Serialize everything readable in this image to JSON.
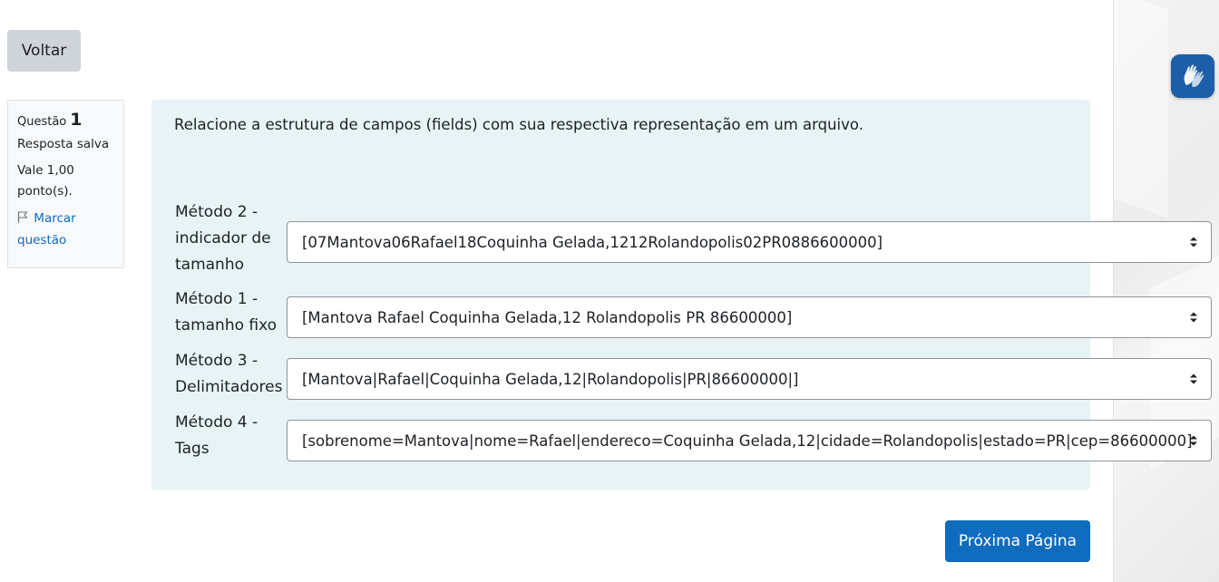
{
  "nav": {
    "back_label": "Voltar",
    "next_label": "Próxima Página"
  },
  "question_info": {
    "question_label": "Questão",
    "question_number": "1",
    "status": "Resposta salva",
    "grade_line1": "Vale 1,00",
    "grade_line2": "ponto(s).",
    "flag_line1": "Marcar",
    "flag_line2": "questão",
    "flag_icon": "flag-icon"
  },
  "question": {
    "prompt": "Relacione a estrutura de campos (fields) com sua respectiva representação em um arquivo.",
    "rows": [
      {
        "label_lines": [
          "Método 2 -",
          "indicador de",
          "tamanho"
        ],
        "selected": "[07Mantova06Rafael18Coquinha Gelada,1212Rolandopolis02PR0886600000]"
      },
      {
        "label_lines": [
          "Método 1 -",
          "tamanho fixo"
        ],
        "selected": "[Mantova Rafael Coquinha Gelada,12 Rolandopolis PR 86600000]"
      },
      {
        "label_lines": [
          "Método 3 -",
          "Delimitadores"
        ],
        "selected": "[Mantova|Rafael|Coquinha Gelada,12|Rolandopolis|PR|86600000|]"
      },
      {
        "label_lines": [
          "Método 4 -",
          "Tags"
        ],
        "selected": "[sobrenome=Mantova|nome=Rafael|endereco=Coquinha Gelada,12|cidade=Rolandopolis|estado=PR|cep=86600000]"
      }
    ]
  },
  "accessibility_widget": {
    "icon": "sign-language-hands-icon"
  },
  "colors": {
    "primary": "#0f6cbf",
    "panel_bg": "#e7f3f5",
    "secondary_btn": "#ced4da",
    "vlibras_bg": "#1d5ea8"
  }
}
